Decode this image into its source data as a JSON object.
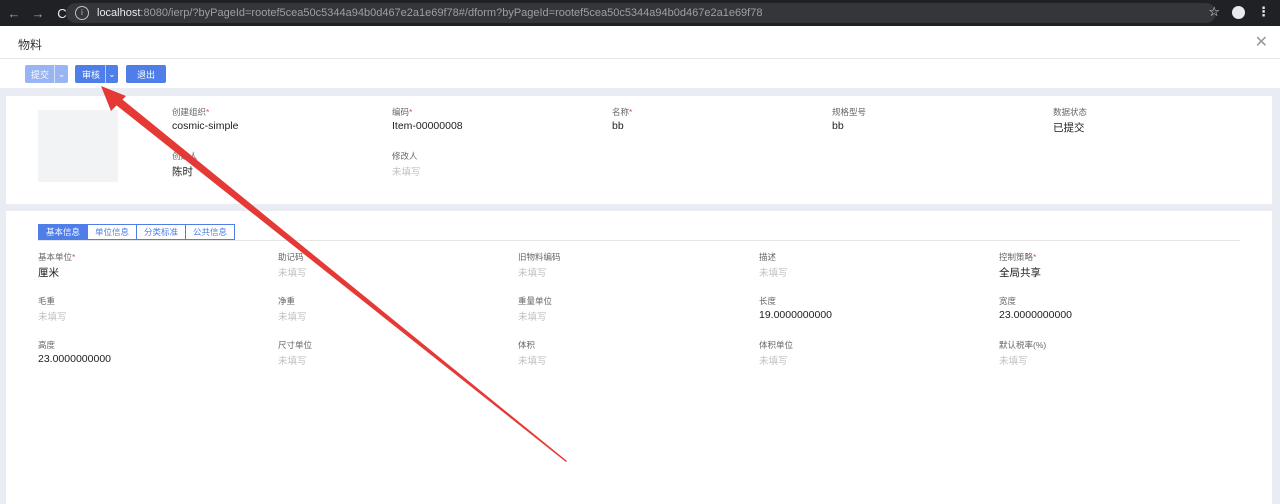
{
  "browser": {
    "url_host": "localhost",
    "url_rest": ":8080/ierp/?byPageId=rootef5cea50c5344a94b0d467e2a1e69f78#/dform?byPageId=rootef5cea50c5344a94b0d467e2a1e69f78",
    "back_icon": "←",
    "forward_icon": "→",
    "reload_icon": "C",
    "info_icon": "i",
    "star_icon": "☆",
    "kebab_icon": "⋮"
  },
  "header": {
    "title": "物料",
    "close_icon": "✕"
  },
  "toolbar": {
    "submit": "提交",
    "audit": "审核",
    "exit": "退出",
    "dropdown_icon": "⌄"
  },
  "summary": {
    "fields": [
      {
        "label": "创建组织",
        "required": "*",
        "value": "cosmic-simple"
      },
      {
        "label": "编码",
        "required": "*",
        "value": "Item-00000008"
      },
      {
        "label": "名称",
        "required": "*",
        "value": "bb"
      },
      {
        "label": "规格型号",
        "required": "",
        "value": "bb"
      },
      {
        "label": "数据状态",
        "required": "",
        "value": "已提交"
      },
      {
        "label": "创建人",
        "required": "",
        "value": "陈时"
      },
      {
        "label": "修改人",
        "required": "",
        "value": "未填写"
      }
    ]
  },
  "tabs": [
    "基本信息",
    "单位信息",
    "分类标准",
    "公共信息"
  ],
  "basic": {
    "fields": [
      {
        "label": "基本单位",
        "required": "*",
        "value": "厘米"
      },
      {
        "label": "助记码",
        "required": "",
        "value": "未填写"
      },
      {
        "label": "旧物料编码",
        "required": "",
        "value": "未填写"
      },
      {
        "label": "描述",
        "required": "",
        "value": "未填写"
      },
      {
        "label": "控制策略",
        "required": "*",
        "value": "全局共享"
      },
      {
        "label": "毛重",
        "required": "",
        "value": "未填写"
      },
      {
        "label": "净重",
        "required": "",
        "value": "未填写"
      },
      {
        "label": "重量单位",
        "required": "",
        "value": "未填写"
      },
      {
        "label": "长度",
        "required": "",
        "value": "19.0000000000"
      },
      {
        "label": "宽度",
        "required": "",
        "value": "23.0000000000"
      },
      {
        "label": "高度",
        "required": "",
        "value": "23.0000000000"
      },
      {
        "label": "尺寸单位",
        "required": "",
        "value": "未填写"
      },
      {
        "label": "体积",
        "required": "",
        "value": "未填写"
      },
      {
        "label": "体积单位",
        "required": "",
        "value": "未填写"
      },
      {
        "label": "默认税率(%)",
        "required": "",
        "value": "未填写"
      }
    ]
  },
  "colors": {
    "primary": "#4f7ee8",
    "primary_light": "#98b4f2",
    "annotation": "#e53935"
  }
}
